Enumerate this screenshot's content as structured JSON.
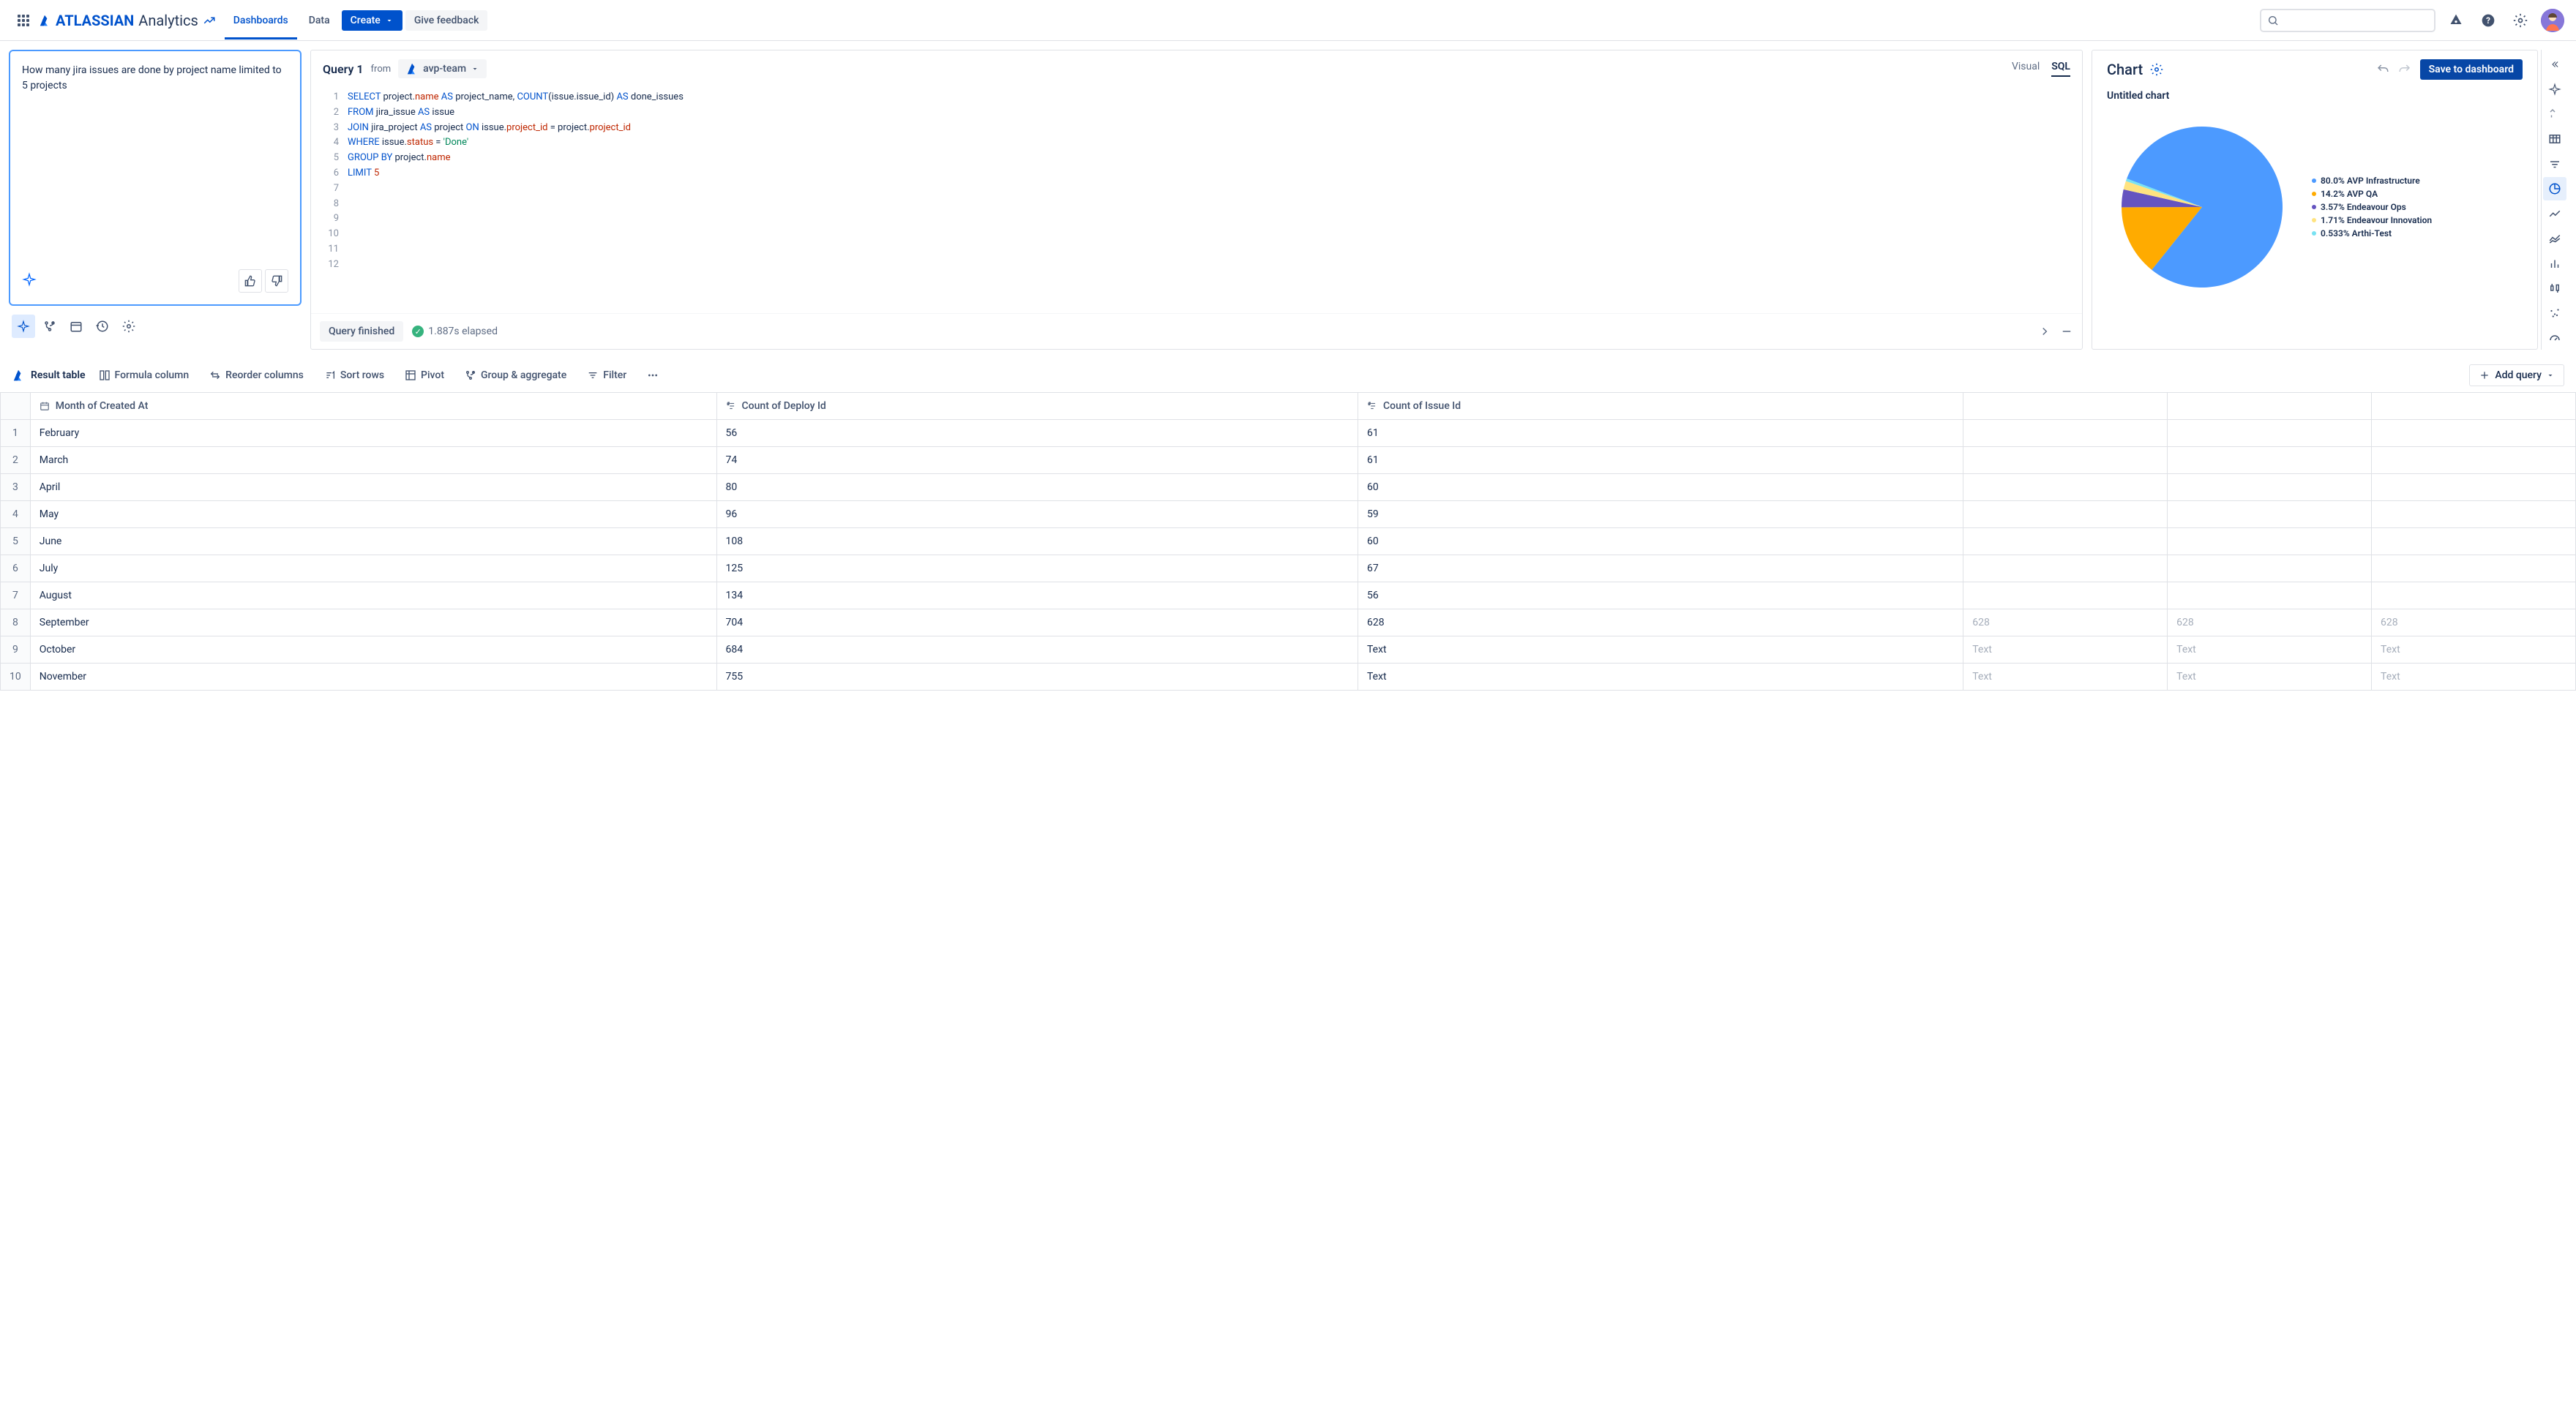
{
  "nav": {
    "brand_a": "ATLASSIAN",
    "brand_b": "Analytics",
    "items": [
      "Dashboards",
      "Data"
    ],
    "create": "Create",
    "feedback": "Give feedback"
  },
  "prompt": {
    "text": "How many jira issues are done by project name limited to 5 projects"
  },
  "query": {
    "title": "Query 1",
    "from": "from",
    "team": "avp-team",
    "tabs": {
      "visual": "Visual",
      "sql": "SQL"
    },
    "lines": [
      "SELECT project.name AS project_name, COUNT(issue.issue_id) AS done_issues",
      "FROM jira_issue AS issue",
      "JOIN jira_project AS project ON issue.project_id = project.project_id",
      "WHERE issue.status = 'Done'",
      "GROUP BY project.name",
      "LIMIT 5",
      "",
      "",
      "",
      "",
      "",
      ""
    ],
    "status_label": "Query finished",
    "elapsed": "1.887s elapsed"
  },
  "chart": {
    "panel_title": "Chart",
    "save": "Save to dashboard",
    "title": "Untitled chart"
  },
  "chart_data": {
    "type": "pie",
    "title": "Untitled chart",
    "series": [
      {
        "name": "AVP Infrastructure",
        "value": 80.0,
        "color": "#4c9aff"
      },
      {
        "name": "AVP QA",
        "value": 14.2,
        "color": "#ffab00"
      },
      {
        "name": "Endeavour Ops",
        "value": 3.57,
        "color": "#6554c0"
      },
      {
        "name": "Endeavour Innovation",
        "value": 1.71,
        "color": "#ffe380"
      },
      {
        "name": "Arthi-Test",
        "value": 0.533,
        "color": "#79e2f2"
      }
    ],
    "legend_labels": [
      "80.0% AVP Infrastructure",
      "14.2% AVP QA",
      "3.57% Endeavour Ops",
      "1.71% Endeavour Innovation",
      "0.533% Arthi-Test"
    ]
  },
  "result": {
    "title": "Result table",
    "buttons": {
      "formula": "Formula column",
      "reorder": "Reorder columns",
      "sort": "Sort rows",
      "pivot": "Pivot",
      "group": "Group & aggregate",
      "filter": "Filter",
      "add_query": "Add query"
    },
    "columns": [
      "Month of Created At",
      "Count of Deploy Id",
      "Count of Issue Id"
    ],
    "rows": [
      {
        "n": 1,
        "c": [
          "February",
          "56",
          "61",
          "",
          "",
          ""
        ]
      },
      {
        "n": 2,
        "c": [
          "March",
          "74",
          "61",
          "",
          "",
          ""
        ]
      },
      {
        "n": 3,
        "c": [
          "April",
          "80",
          "60",
          "",
          "",
          ""
        ]
      },
      {
        "n": 4,
        "c": [
          "May",
          "96",
          "59",
          "",
          "",
          ""
        ]
      },
      {
        "n": 5,
        "c": [
          "June",
          "108",
          "60",
          "",
          "",
          ""
        ]
      },
      {
        "n": 6,
        "c": [
          "July",
          "125",
          "67",
          "",
          "",
          ""
        ]
      },
      {
        "n": 7,
        "c": [
          "August",
          "134",
          "56",
          "",
          "",
          ""
        ]
      },
      {
        "n": 8,
        "c": [
          "September",
          "704",
          "628",
          "628",
          "628",
          "628"
        ]
      },
      {
        "n": 9,
        "c": [
          "October",
          "684",
          "Text",
          "Text",
          "Text",
          "Text"
        ]
      },
      {
        "n": 10,
        "c": [
          "November",
          "755",
          "Text",
          "Text",
          "Text",
          "Text"
        ]
      }
    ]
  }
}
